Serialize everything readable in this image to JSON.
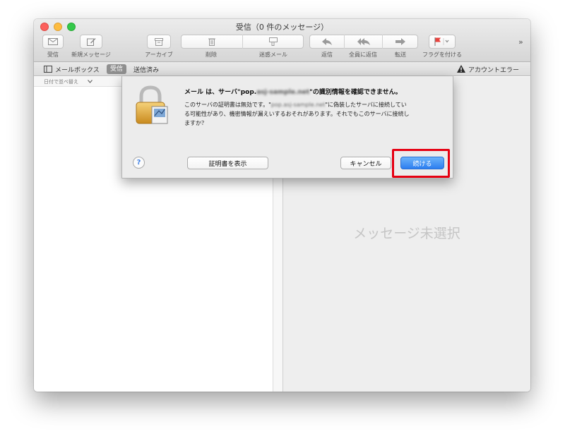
{
  "window": {
    "title": "受信（0 件のメッセージ）"
  },
  "toolbar": {
    "get_mail_label": "受信",
    "new_message_label": "新規メッセージ",
    "archive_label": "アーカイブ",
    "delete_label": "削除",
    "junk_label": "迷惑メール",
    "reply_label": "返信",
    "reply_all_label": "全員に返信",
    "forward_label": "転送",
    "flag_label": "フラグを付ける",
    "overflow": "»"
  },
  "favorites": {
    "mailboxes_label": "メールボックス",
    "inbox_label": "受信",
    "sent_label": "送信済み",
    "account_error_label": "アカウントエラー"
  },
  "message_list": {
    "sort_label": "日付で並べ替え"
  },
  "preview": {
    "no_message_label": "メッセージ未選択"
  },
  "dialog": {
    "title_prefix": "メール は、サーバ\"pop.",
    "title_blurred": "asj-sample.net",
    "title_suffix": "\"の識別情報を確認できません。",
    "body_line1_prefix": "このサーバの証明書は無効です。\"",
    "body_blurred": "pop.asj-sample.net",
    "body_line1_suffix": "\"に偽装したサーバに接続してい",
    "body_line2": "る可能性があり、機密情報が漏えいするおそれがあります。それでもこのサーバに接続し",
    "body_line3": "ますか？",
    "help_label": "?",
    "show_certificate_label": "証明書を表示",
    "cancel_label": "キャンセル",
    "continue_label": "続ける"
  },
  "colors": {
    "accent": "#2c7ef0",
    "highlight": "#e60012",
    "close": "#fc605c",
    "minimize": "#fdbc40",
    "maximize": "#34c84a"
  }
}
